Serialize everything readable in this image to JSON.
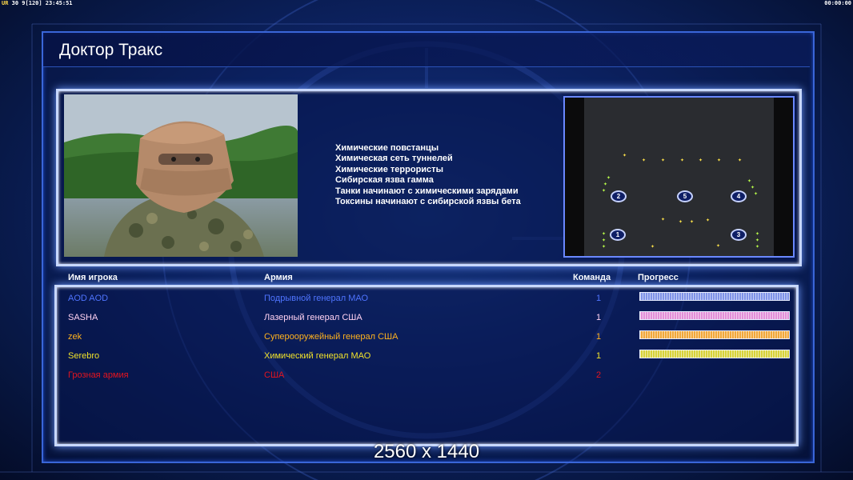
{
  "hud": {
    "left_prefix": "UR",
    "left_rest": "30 9[120] 23:45:51",
    "right": "00:00:00"
  },
  "title": "Доктор Тракс",
  "objectives": [
    "Химические повстанцы",
    "Химическая сеть туннелей",
    "Химические террористы",
    "Сибирская язва гамма",
    "Танки начинают с химическими зарядами",
    "Токсины начинают с сибирской язвы бета"
  ],
  "minimap": {
    "slots": [
      "1",
      "2",
      "3",
      "4",
      "5"
    ]
  },
  "players_table": {
    "headers": {
      "name": "Имя игрока",
      "army": "Армия",
      "team": "Команда",
      "progress": "Прогресс"
    },
    "rows": [
      {
        "name": "AOD AOD",
        "army": "Подрывной генерал МАО",
        "team": "1",
        "color": "#4f74ff",
        "progress": 1.0,
        "bar_color": "#7f93e8"
      },
      {
        "name": "SASHA",
        "army": "Лазерный генерал США",
        "team": "1",
        "color": "#ffd2f2",
        "progress": 1.0,
        "bar_color": "#e28fd8"
      },
      {
        "name": "zek",
        "army": "Суперооружейный генерал США",
        "team": "1",
        "color": "#ffb21e",
        "progress": 1.0,
        "bar_color": "#f2a83a"
      },
      {
        "name": "Serebro",
        "army": "Химический генерал МАО",
        "team": "1",
        "color": "#f0e12a",
        "progress": 1.0,
        "bar_color": "#d8d23a"
      },
      {
        "name": "Грозная армия",
        "army": "США",
        "team": "2",
        "color": "#e5141f",
        "progress": 0
      }
    ]
  },
  "resolution": "2560 x 1440"
}
